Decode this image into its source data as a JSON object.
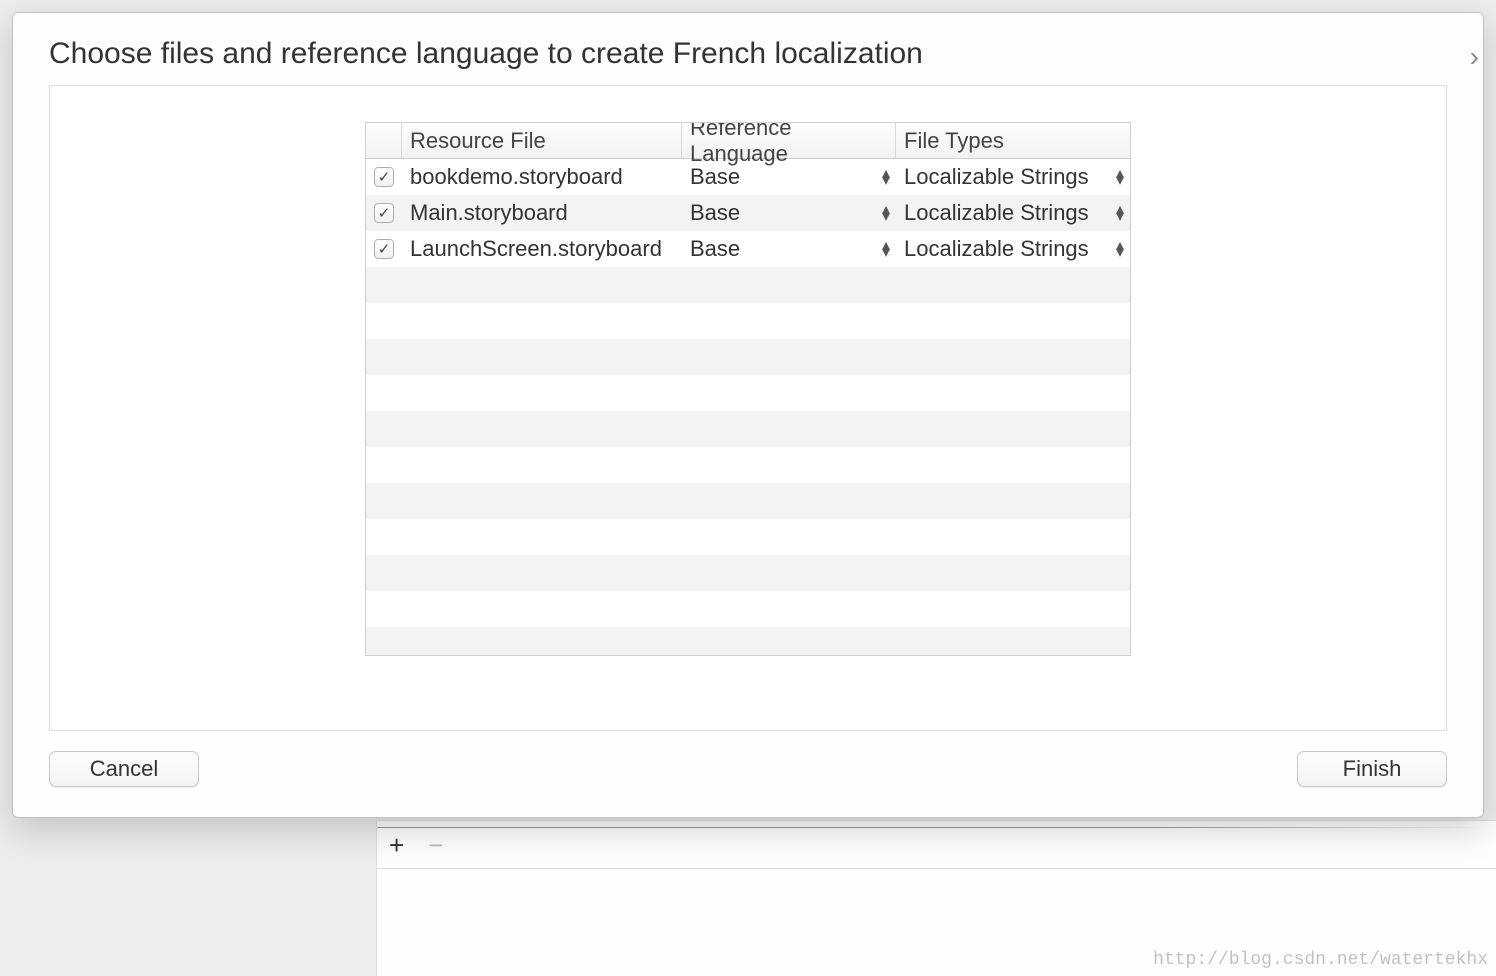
{
  "sheet": {
    "title": "Choose files and reference language to create French localization",
    "columns": {
      "resource_file": "Resource File",
      "reference_language": "Reference Language",
      "file_types": "File Types"
    },
    "rows": [
      {
        "checked": true,
        "file": "bookdemo.storyboard",
        "lang": "Base",
        "type": "Localizable Strings"
      },
      {
        "checked": true,
        "file": "Main.storyboard",
        "lang": "Base",
        "type": "Localizable Strings"
      },
      {
        "checked": true,
        "file": "LaunchScreen.storyboard",
        "lang": "Base",
        "type": "Localizable Strings"
      }
    ],
    "buttons": {
      "cancel": "Cancel",
      "finish": "Finish"
    }
  },
  "bottom": {
    "plus": "+",
    "minus": "−"
  },
  "watermark": "http://blog.csdn.net/watertekhx"
}
